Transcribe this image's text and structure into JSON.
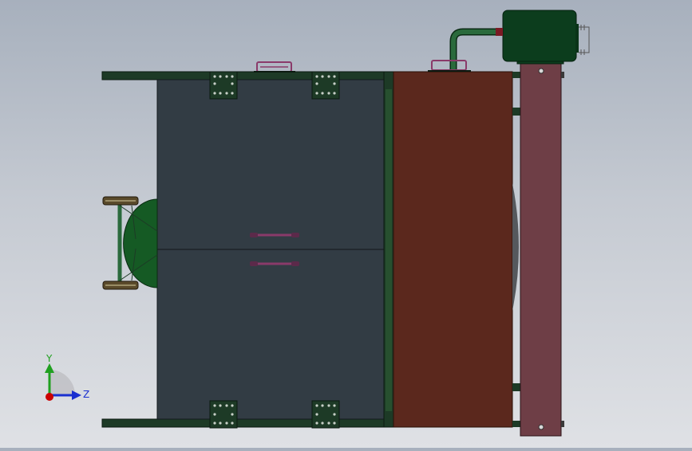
{
  "app": {
    "view": "cad-model-viewport"
  },
  "colors": {
    "tank_body": "#323c44",
    "hopper": "#5b281d",
    "frame_green": "#1d3a26",
    "motor_green": "#0c3d1d",
    "pipe_green": "#2a6a3c",
    "plate": "#6e3e46",
    "handle": "#8a3a6a",
    "dome": "#155a24",
    "axis_x": "#cc0000",
    "axis_y": "#20a020",
    "axis_z": "#1a2fd0"
  },
  "triad": {
    "y_label": "Y",
    "z_label": "Z"
  },
  "icons": {
    "triad": "coordinate-triad-icon",
    "origin": "origin-dot-icon"
  }
}
